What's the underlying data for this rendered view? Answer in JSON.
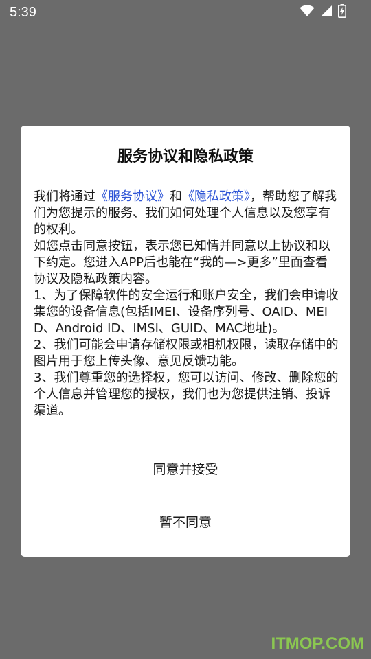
{
  "status_bar": {
    "time": "5:39",
    "icons": [
      "wifi-icon",
      "cell-signal-icon",
      "battery-charging-icon"
    ]
  },
  "dialog": {
    "title": "服务协议和隐私政策",
    "paragraphs": {
      "p1_before": "我们将通过",
      "p1_link1": "《服务协议》",
      "p1_mid": "和",
      "p1_link2": "《隐私政策》",
      "p1_after": "，帮助您了解我们为您提示的服务、我们如何处理个人信息以及您享有的权利。",
      "p2": "如您点击同意按钮，表示您已知情并同意以上协议和以下约定。您进入APP后也能在“我的—>更多”里面查看协议及隐私政策内容。",
      "p3": "1、为了保障软件的安全运行和账户安全，我们会申请收集您的设备信息(包括IMEI、设备序列号、OAID、MEID、Android ID、IMSI、GUID、MAC地址)。",
      "p4": "2、我们可能会申请存储权限或相机权限，读取存储中的图片用于您上传头像、意见反馈功能。",
      "p5": "3、我们尊重您的选择权，您可以访问、修改、删除您的个人信息并管理您的授权，我们也为您提供注销、投诉渠道。"
    },
    "agree_label": "同意并接受",
    "decline_label": "暂不同意",
    "link_color": "#2e55d6"
  },
  "watermark": "ITMOP.COM"
}
